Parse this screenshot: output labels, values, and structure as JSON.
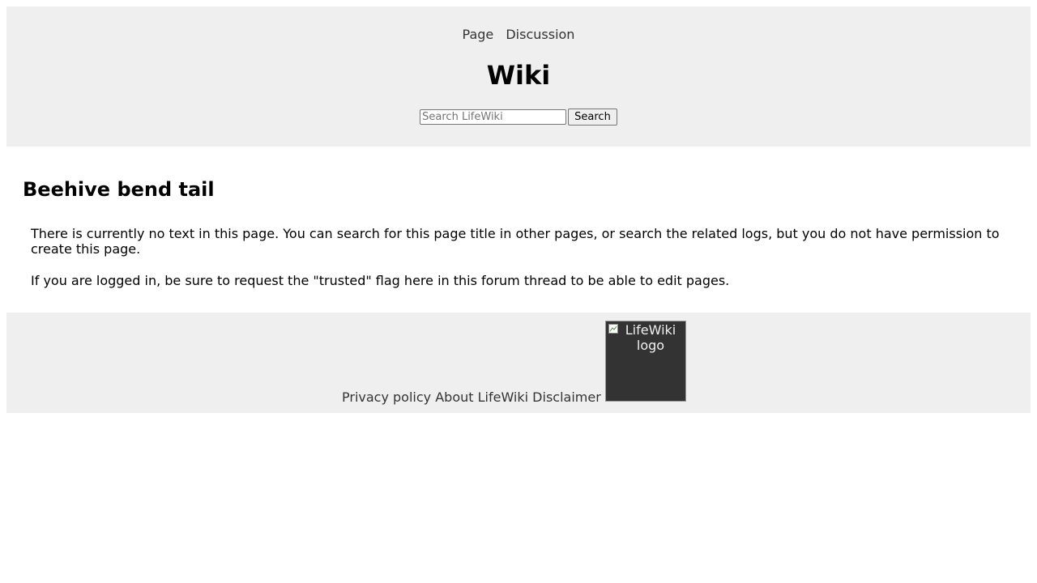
{
  "header": {
    "tabs": [
      {
        "label": "Page"
      },
      {
        "label": "Discussion"
      }
    ],
    "site_title": "Wiki",
    "search": {
      "placeholder": "Search LifeWiki",
      "value": "",
      "button_label": "Search"
    }
  },
  "main": {
    "title": "Beehive bend tail",
    "paragraphs": [
      "There is currently no text in this page. You can search for this page title in other pages, or search the related logs, but you do not have permission to create this page.",
      "If you are logged in, be sure to request the \"trusted\" flag here in this forum thread to be able to edit pages."
    ]
  },
  "footer": {
    "links": [
      {
        "label": "Privacy policy"
      },
      {
        "label": "About LifeWiki"
      },
      {
        "label": "Disclaimer"
      }
    ],
    "logo_alt": "LifeWiki logo"
  },
  "colors": {
    "bar_background": "#efefef",
    "link_text": "#333333",
    "logo_background": "#333333"
  }
}
